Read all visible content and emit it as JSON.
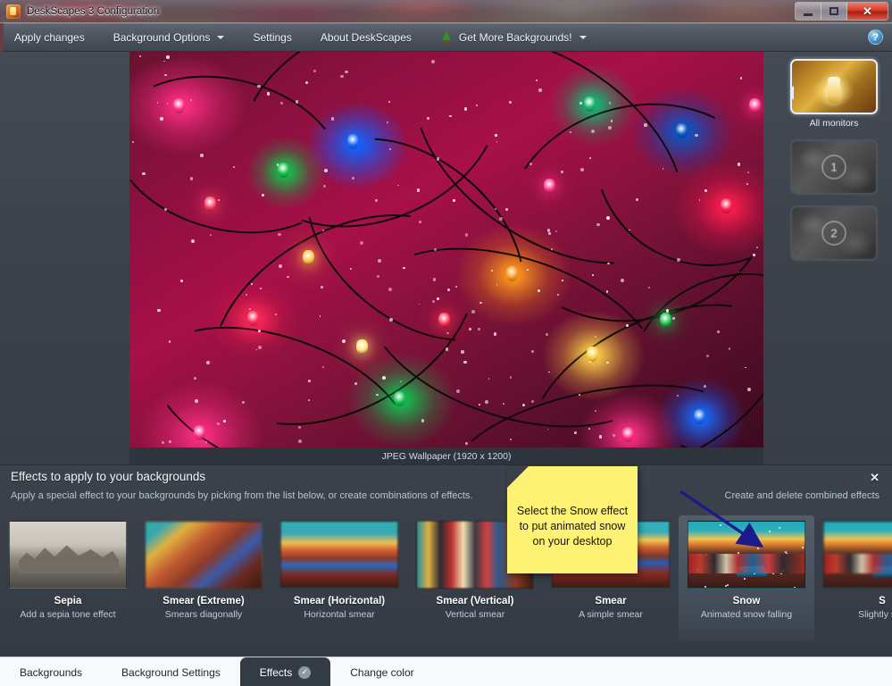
{
  "window": {
    "title": "DeskScapes 3 Configuration",
    "icon": "deskscapes-app-icon",
    "controls": {
      "minimize": "–",
      "maximize": "□",
      "close": "✕"
    }
  },
  "menubar": {
    "items": [
      {
        "label": "Apply changes",
        "has_caret": false
      },
      {
        "label": "Background Options",
        "has_caret": true
      },
      {
        "label": "Settings",
        "has_caret": false
      },
      {
        "label": "About DeskScapes",
        "has_caret": false
      },
      {
        "label": "Get More Backgrounds!",
        "has_caret": true,
        "icon": "christmas-tree-icon"
      }
    ],
    "help_label": "?"
  },
  "preview": {
    "caption": "JPEG Wallpaper (1920 x 1200)"
  },
  "monitors": {
    "all_label": "All monitors",
    "items": [
      {
        "id": "all",
        "label": "All monitors",
        "selected": true
      },
      {
        "id": "1",
        "label": "1",
        "selected": false
      },
      {
        "id": "2",
        "label": "2",
        "selected": false
      }
    ]
  },
  "effects_panel": {
    "title": "Effects to apply to your backgrounds",
    "subtitle": "Apply a special effect to your backgrounds by picking from the list below, or create combinations of effects.",
    "combined_link": "Create and delete combined effects",
    "close_label": "✕",
    "effects": [
      {
        "name": "Sepia",
        "desc": "Add a sepia tone effect",
        "selected": false,
        "thumb": "thumb-sepia"
      },
      {
        "name": "Smear (Extreme)",
        "desc": "Smears diagonally",
        "selected": false,
        "thumb": "thumb-smear-ex"
      },
      {
        "name": "Smear (Horizontal)",
        "desc": "Horizontal smear",
        "selected": false,
        "thumb": "thumb-smear-h"
      },
      {
        "name": "Smear (Vertical)",
        "desc": "Vertical smear",
        "selected": false,
        "thumb": "thumb-smear-v"
      },
      {
        "name": "Smear",
        "desc": "A simple smear",
        "selected": false,
        "thumb": "thumb-smear"
      },
      {
        "name": "Snow",
        "desc": "Animated snow falling",
        "selected": true,
        "thumb": "thumb-street"
      },
      {
        "name": "S",
        "desc": "Slightly soft",
        "selected": false,
        "thumb": "thumb-street thumb-soft"
      }
    ]
  },
  "sticky_note": {
    "text": "Select the Snow effect to put animated snow on your desktop",
    "color": "#fdf274",
    "arrow_color": "#1a1a8c"
  },
  "tabs": [
    {
      "label": "Backgrounds",
      "active": false,
      "badge": null
    },
    {
      "label": "Background Settings",
      "active": false,
      "badge": null
    },
    {
      "label": "Effects",
      "active": true,
      "badge": "✓"
    },
    {
      "label": "Change color",
      "active": false,
      "badge": null
    }
  ]
}
